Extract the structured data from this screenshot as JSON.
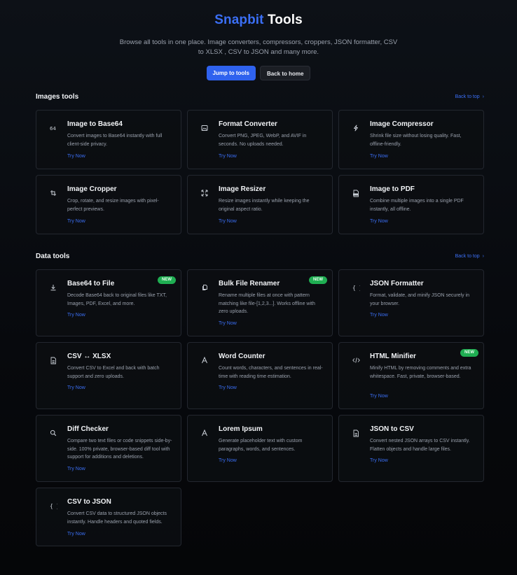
{
  "hero": {
    "brand": "Snapbit",
    "title_rest": "Tools",
    "subtitle": "Browse all tools in one place. Image converters, compressors, croppers, JSON formatter, CSV to XLSX , CSV to JSON and many more.",
    "jump_label": "Jump to tools",
    "home_label": "Back to home"
  },
  "sections": {
    "images": {
      "title": "Images tools",
      "back_top": "Back to top"
    },
    "data": {
      "title": "Data tools",
      "back_top": "Back to top"
    }
  },
  "cards": [
    {
      "title": "Image to Base64",
      "desc": "Convert images to Base64 instantly with full client-side privacy.",
      "cta": "Try Now",
      "icon": "base64-icon"
    },
    {
      "title": "Format Converter",
      "desc": "Convert PNG, JPEG, WebP, and AVIF in seconds. No uploads needed.",
      "cta": "Try Now",
      "icon": "image-icon"
    },
    {
      "title": "Image Compressor",
      "desc": "Shrink file size without losing quality. Fast, offline-friendly.",
      "cta": "Try Now",
      "icon": "bolt-icon"
    },
    {
      "title": "Image Cropper",
      "desc": "Crop, rotate, and resize images with pixel-perfect previews.",
      "cta": "Try Now",
      "icon": "crop-icon"
    },
    {
      "title": "Image Resizer",
      "desc": "Resize images instantly while keeping the original aspect ratio.",
      "cta": "Try Now",
      "icon": "resize-icon"
    },
    {
      "title": "Image to PDF",
      "desc": "Combine multiple images into a single PDF instantly, all offline.",
      "cta": "Try Now",
      "icon": "pdf-icon"
    },
    {
      "title": "Base64 to File",
      "desc": "Decode Base64 back to original files like TXT, Images, PDF, Excel, and more.",
      "cta": "Try Now",
      "icon": "download-icon",
      "badge": "NEW"
    },
    {
      "title": "Bulk File Renamer",
      "desc": "Rename multiple files at once with pattern matching like file-[1,2,3...]. Works offline with zero uploads.",
      "cta": "Try Now",
      "icon": "files-icon",
      "badge": "NEW"
    },
    {
      "title": "JSON Formatter",
      "desc": "Format, validate, and minify JSON securely in your browser.",
      "cta": "Try Now",
      "icon": "braces-icon"
    },
    {
      "title": "CSV ↔ XLSX",
      "desc": "Convert CSV to Excel and back with batch support and zero uploads.",
      "cta": "Try Now",
      "icon": "sheet-icon"
    },
    {
      "title": "Word Counter",
      "desc": "Count words, characters, and sentences in real-time with reading time estimation.",
      "cta": "Try Now",
      "icon": "text-icon"
    },
    {
      "title": "HTML Minifier",
      "desc": "Minify HTML by removing comments and extra whitespace. Fast, private, browser-based.",
      "cta": "Try Now",
      "icon": "code-icon",
      "badge": "NEW"
    },
    {
      "title": "Diff Checker",
      "desc": "Compare two text files or code snippets side-by-side. 100% private, browser-based diff tool with support for additions and deletions.",
      "cta": "Try Now",
      "icon": "search-icon"
    },
    {
      "title": "Lorem Ipsum",
      "desc": "Generate placeholder text with custom paragraphs, words, and sentences.",
      "cta": "Try Now",
      "icon": "text-icon"
    },
    {
      "title": "JSON to CSV",
      "desc": "Convert nested JSON arrays to CSV instantly. Flatten objects and handle large files.",
      "cta": "Try Now",
      "icon": "sheet-icon"
    },
    {
      "title": "CSV to JSON",
      "desc": "Convert CSV data to structured JSON objects instantly. Handle headers and quoted fields.",
      "cta": "Try Now",
      "icon": "braces-icon"
    }
  ]
}
